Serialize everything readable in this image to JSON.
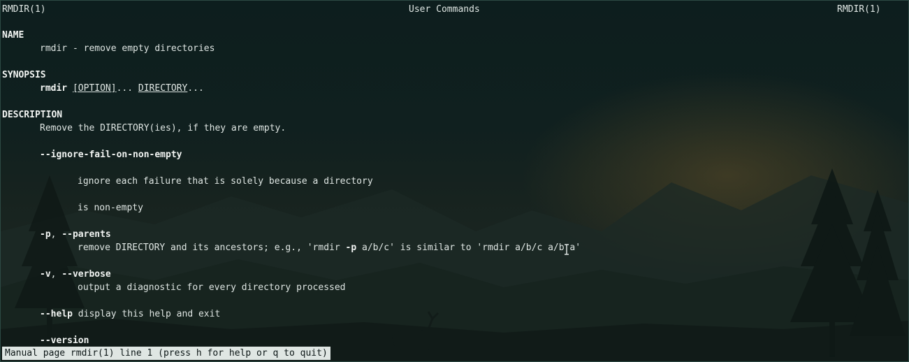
{
  "header": {
    "left": "RMDIR(1)",
    "center": "User Commands",
    "right": "RMDIR(1)"
  },
  "name": {
    "heading": "NAME",
    "text": "rmdir - remove empty directories"
  },
  "synopsis": {
    "heading": "SYNOPSIS",
    "command": "rmdir",
    "option": "[OPTION]",
    "ellipsis1": "...",
    "directory": "DIRECTORY",
    "ellipsis2": "..."
  },
  "description": {
    "heading": "DESCRIPTION",
    "intro": "Remove the DIRECTORY(ies), if they are empty.",
    "ignore_flag": "--ignore-fail-on-non-empty",
    "ignore_text1": "ignore each failure that is solely because a directory",
    "ignore_text2": "is non-empty",
    "parents_flag_short": "-p",
    "parents_sep": ", ",
    "parents_flag_long": "--parents",
    "parents_text_a": "remove DIRECTORY and its ancestors; e.g., 'rmdir ",
    "parents_text_b": "-p",
    "parents_text_c": " a/b/c' is similar to 'rmdir a/b/c a/b a'",
    "verbose_flag_short": "-v",
    "verbose_sep": ", ",
    "verbose_flag_long": "--verbose",
    "verbose_text": "output a diagnostic for every directory processed",
    "help_flag": "--help",
    "help_text": " display this help and exit",
    "version_flag": "--version"
  },
  "status_bar": {
    "text": "Manual page rmdir(1) line 1 (press h for help or q to quit)"
  },
  "colors": {
    "text": "#dfe6e3",
    "background": "#0e1c1c",
    "status_bg": "#dfe6e3"
  }
}
